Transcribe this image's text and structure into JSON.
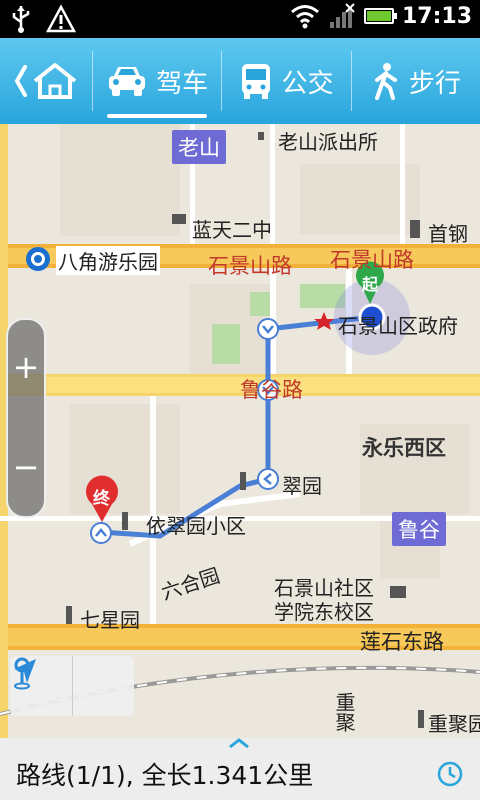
{
  "status_bar": {
    "time": "17:13"
  },
  "tabs": [
    {
      "id": "home",
      "label": ""
    },
    {
      "id": "drive",
      "label": "驾车"
    },
    {
      "id": "bus",
      "label": "公交"
    },
    {
      "id": "walk",
      "label": "步行"
    }
  ],
  "map": {
    "labels": {
      "laoshan": "老山",
      "police": "老山派出所",
      "lantian": "蓝天二中",
      "shougang": "首钢",
      "bajiao": "八角游乐园",
      "shijingshan_road_1": "石景山路",
      "shijingshan_road_2": "石景山路",
      "gov": "石景山区政府",
      "lugu_road": "鲁谷路",
      "yongle": "永乐西区",
      "yicuiyuan": "翠园",
      "yicui_xiaoqu": "依翠园小区",
      "lugu_badge": "鲁谷",
      "liuhe": "六合园",
      "shequ_1": "石景山社区",
      "shequ_2": "学院东校区",
      "qixing": "七星园",
      "lianshi": "莲石东路",
      "chongju_1": "重聚园",
      "chongju_v": "重聚",
      "start_marker": "起",
      "end_marker": "终"
    }
  },
  "zoom": {
    "plus": "+",
    "minus": "−"
  },
  "bottom": {
    "route_summary": "路线(1/1), 全长1.341公里"
  },
  "colors": {
    "accent": "#29a5dc",
    "route": "#4a7fd6",
    "road_yellow": "#f5d46b",
    "road_orange": "#f2b23a"
  }
}
